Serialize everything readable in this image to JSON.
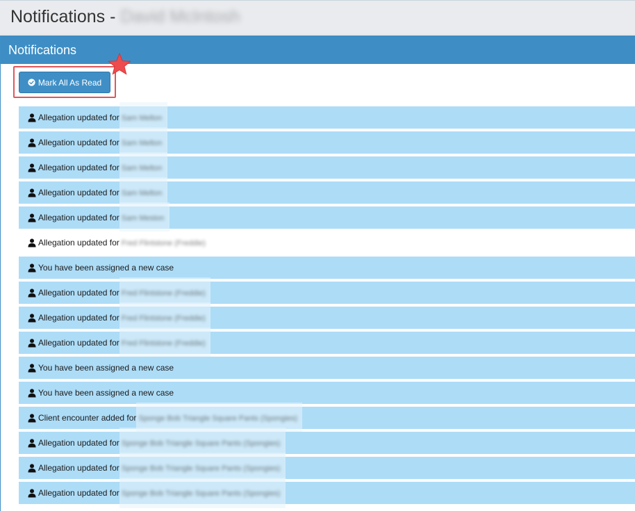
{
  "page": {
    "title": "Notifications - ",
    "title_name": "David McIntosh"
  },
  "panel": {
    "heading": "Notifications"
  },
  "toolbar": {
    "mark_all_label": "Mark All As Read",
    "mark_all_icon": "check-circle-icon"
  },
  "colors": {
    "unread_row": "#addcf7",
    "read_row": "#ffffff",
    "panel_heading": "#3e8ec5",
    "highlight": "#e0575a",
    "star": "#ee4b4e"
  },
  "notifications": [
    {
      "text": "Allegation updated for",
      "name": "Sam Melton",
      "read": false,
      "icon": "user-icon"
    },
    {
      "text": "Allegation updated for",
      "name": "Sam Melton",
      "read": false,
      "icon": "user-icon"
    },
    {
      "text": "Allegation updated for",
      "name": "Sam Melton",
      "read": false,
      "icon": "user-icon"
    },
    {
      "text": "Allegation updated for",
      "name": "Sam Melton",
      "read": false,
      "icon": "user-icon"
    },
    {
      "text": "Allegation updated for",
      "name": "Sam Meston",
      "read": false,
      "icon": "user-icon"
    },
    {
      "text": "Allegation updated for",
      "name": "Fred Flintstone (Freddie)",
      "read": true,
      "icon": "user-icon"
    },
    {
      "text": "You have been assigned a new case",
      "name": "",
      "read": false,
      "icon": "user-icon"
    },
    {
      "text": "Allegation updated for",
      "name": "Fred Flintstone (Freddie)",
      "read": false,
      "icon": "user-icon"
    },
    {
      "text": "Allegation updated for",
      "name": "Fred Flintstone (Freddie)",
      "read": false,
      "icon": "user-icon"
    },
    {
      "text": "Allegation updated for",
      "name": "Fred Flintstone (Freddie)",
      "read": false,
      "icon": "user-icon"
    },
    {
      "text": "You have been assigned a new case",
      "name": "",
      "read": false,
      "icon": "user-icon"
    },
    {
      "text": "You have been assigned a new case",
      "name": "",
      "read": false,
      "icon": "user-icon"
    },
    {
      "text": "Client encounter added for",
      "name": "Sponge Bob Triangle Square Pants (Spongies)",
      "read": false,
      "icon": "user-icon"
    },
    {
      "text": "Allegation updated for",
      "name": "Sponge Bob Triangle Square Pants (Spongies)",
      "read": false,
      "icon": "user-icon"
    },
    {
      "text": "Allegation updated for",
      "name": "Sponge Bob Triangle Square Pants (Spongies)",
      "read": false,
      "icon": "user-icon"
    },
    {
      "text": "Allegation updated for",
      "name": "Sponge Bob Triangle Square Pants (Spongies)",
      "read": false,
      "icon": "user-icon"
    }
  ]
}
